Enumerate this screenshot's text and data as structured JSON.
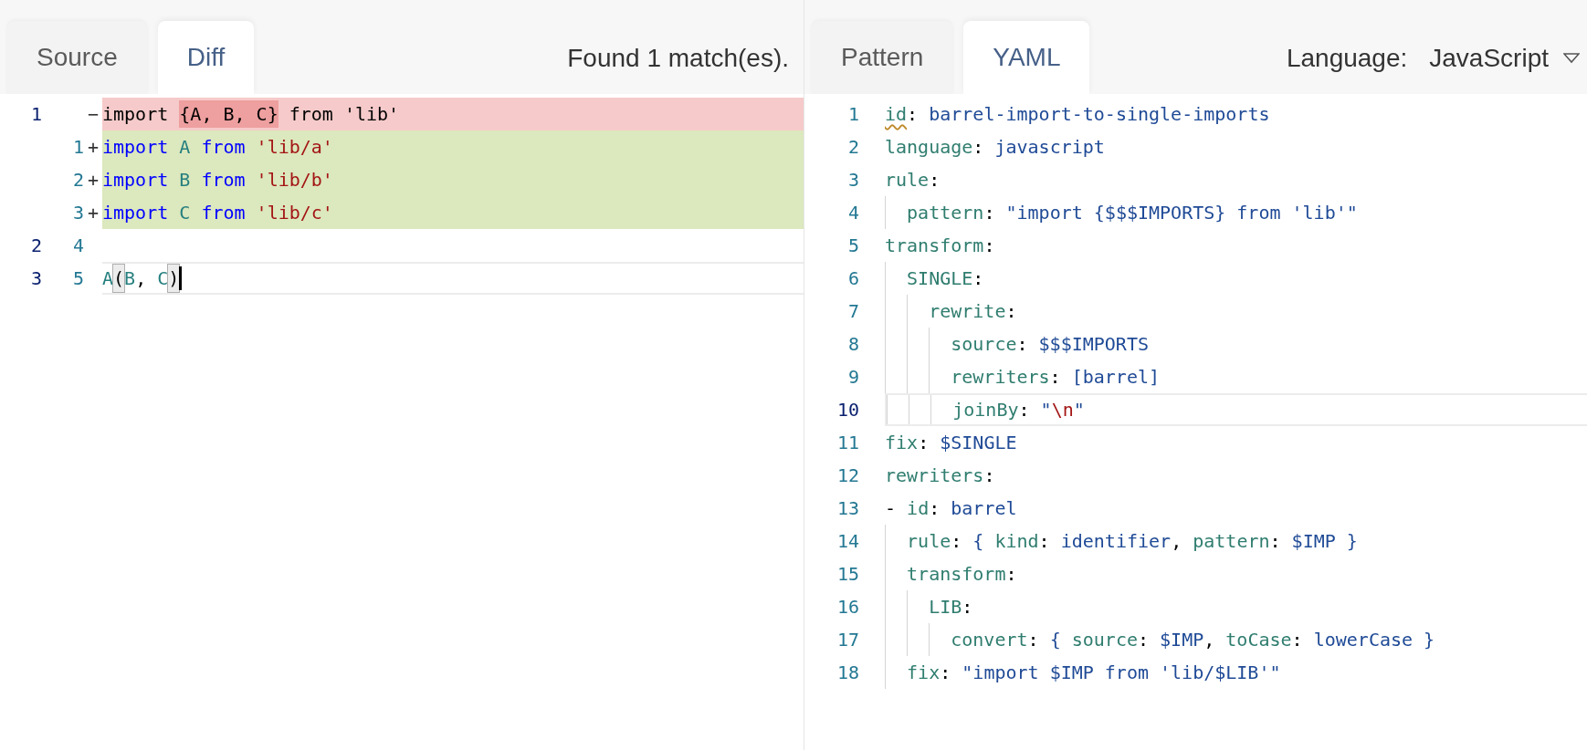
{
  "left_panel": {
    "tabs": [
      {
        "label": "Source",
        "selected": false
      },
      {
        "label": "Diff",
        "selected": true
      }
    ],
    "status": "Found 1 match(es).",
    "diff_lines": [
      {
        "old": "1",
        "marker": "−",
        "kind": "removed",
        "current": false,
        "cursor": false,
        "tokens": [
          {
            "text": "import ",
            "kind": "plain"
          },
          {
            "text": "{A, B, C}",
            "kind": "plain",
            "changed": true
          },
          {
            "text": " from 'lib'",
            "kind": "plain"
          }
        ]
      },
      {
        "new": "1",
        "marker": "+",
        "kind": "added",
        "current": false,
        "cursor": false,
        "tokens": [
          {
            "text": "import ",
            "kind": "kw"
          },
          {
            "text": "A ",
            "kind": "ident"
          },
          {
            "text": "from ",
            "kind": "kw"
          },
          {
            "text": "'lib/a'",
            "kind": "str"
          }
        ]
      },
      {
        "new": "2",
        "marker": "+",
        "kind": "added",
        "current": false,
        "cursor": false,
        "tokens": [
          {
            "text": "import ",
            "kind": "kw"
          },
          {
            "text": "B ",
            "kind": "ident"
          },
          {
            "text": "from ",
            "kind": "kw"
          },
          {
            "text": "'lib/b'",
            "kind": "str"
          }
        ]
      },
      {
        "new": "3",
        "marker": "+",
        "kind": "added",
        "current": false,
        "cursor": false,
        "tokens": [
          {
            "text": "import ",
            "kind": "kw"
          },
          {
            "text": "C ",
            "kind": "ident"
          },
          {
            "text": "from ",
            "kind": "kw"
          },
          {
            "text": "'lib/c'",
            "kind": "str"
          }
        ]
      },
      {
        "old": "2",
        "new": "4",
        "kind": "context",
        "current": false,
        "cursor": false
      },
      {
        "old": "3",
        "new": "5",
        "kind": "context",
        "current": true,
        "cursor": true,
        "tokens": [
          {
            "text": "A",
            "kind": "ident"
          },
          {
            "text": "(",
            "kind": "plain",
            "match": true
          },
          {
            "text": "B",
            "kind": "ident"
          },
          {
            "text": ", ",
            "kind": "plain"
          },
          {
            "text": "C",
            "kind": "ident"
          },
          {
            "text": ")",
            "kind": "plain",
            "match": true
          }
        ]
      }
    ]
  },
  "right_panel": {
    "tabs": [
      {
        "label": "Pattern",
        "selected": false
      },
      {
        "label": "YAML",
        "selected": true
      }
    ],
    "language_label": "Language:",
    "language": "JavaScript",
    "yaml_lines": [
      {
        "number": "1",
        "current": false,
        "tokens": [
          {
            "text": "id",
            "kind": "key",
            "warning": true
          },
          {
            "text": ": "
          },
          {
            "text": "barrel-import-to-single-imports",
            "kind": "val"
          }
        ]
      },
      {
        "number": "2",
        "current": false,
        "tokens": [
          {
            "text": "language",
            "kind": "key"
          },
          {
            "text": ": "
          },
          {
            "text": "javascript",
            "kind": "val"
          }
        ]
      },
      {
        "number": "3",
        "current": false,
        "tokens": [
          {
            "text": "rule",
            "kind": "key"
          },
          {
            "text": ":"
          }
        ],
        "children": [
          {
            "number": "4",
            "current": false,
            "tokens": [
              {
                "text": "pattern",
                "kind": "key"
              },
              {
                "text": ": "
              },
              {
                "text": "\"import {$$$IMPORTS} from 'lib'\"",
                "kind": "val"
              }
            ]
          }
        ]
      },
      {
        "number": "5",
        "current": false,
        "tokens": [
          {
            "text": "transform",
            "kind": "key"
          },
          {
            "text": ":"
          }
        ],
        "children": [
          {
            "number": "6",
            "current": false,
            "tokens": [
              {
                "text": "SINGLE",
                "kind": "key"
              },
              {
                "text": ":"
              }
            ],
            "children": [
              {
                "number": "7",
                "current": false,
                "tokens": [
                  {
                    "text": "rewrite",
                    "kind": "key"
                  },
                  {
                    "text": ":"
                  }
                ],
                "children": [
                  {
                    "number": "8",
                    "current": false,
                    "tokens": [
                      {
                        "text": "source",
                        "kind": "key"
                      },
                      {
                        "text": ": "
                      },
                      {
                        "text": "$$$IMPORTS",
                        "kind": "val"
                      }
                    ]
                  },
                  {
                    "number": "9",
                    "current": false,
                    "tokens": [
                      {
                        "text": "rewriters",
                        "kind": "key"
                      },
                      {
                        "text": ": "
                      },
                      {
                        "text": "[barrel]",
                        "kind": "val"
                      }
                    ]
                  },
                  {
                    "number": "10",
                    "current": true,
                    "tokens": [
                      {
                        "text": "joinBy",
                        "kind": "key"
                      },
                      {
                        "text": ": "
                      },
                      {
                        "text": "\"",
                        "kind": "val"
                      },
                      {
                        "text": "\\n",
                        "kind": "str"
                      },
                      {
                        "text": "\"",
                        "kind": "val"
                      }
                    ]
                  }
                ]
              }
            ]
          }
        ]
      },
      {
        "number": "11",
        "current": false,
        "tokens": [
          {
            "text": "fix",
            "kind": "key"
          },
          {
            "text": ": "
          },
          {
            "text": "$SINGLE",
            "kind": "val"
          }
        ]
      },
      {
        "number": "12",
        "current": false,
        "tokens": [
          {
            "text": "rewriters",
            "kind": "key"
          },
          {
            "text": ":"
          }
        ]
      },
      {
        "number": "13",
        "current": false,
        "tokens": [
          {
            "text": "- "
          },
          {
            "text": "id",
            "kind": "key"
          },
          {
            "text": ": "
          },
          {
            "text": "barrel",
            "kind": "val"
          }
        ],
        "children": [
          {
            "number": "14",
            "current": false,
            "tokens": [
              {
                "text": "rule",
                "kind": "key"
              },
              {
                "text": ": "
              },
              {
                "text": "{ ",
                "kind": "val"
              },
              {
                "text": "kind",
                "kind": "key"
              },
              {
                "text": ": "
              },
              {
                "text": "identifier",
                "kind": "val"
              },
              {
                "text": ", "
              },
              {
                "text": "pattern",
                "kind": "key"
              },
              {
                "text": ": "
              },
              {
                "text": "$IMP }",
                "kind": "val"
              }
            ]
          },
          {
            "number": "15",
            "current": false,
            "tokens": [
              {
                "text": "transform",
                "kind": "key"
              },
              {
                "text": ":"
              }
            ],
            "children": [
              {
                "number": "16",
                "current": false,
                "tokens": [
                  {
                    "text": "LIB",
                    "kind": "key"
                  },
                  {
                    "text": ":"
                  }
                ],
                "children": [
                  {
                    "number": "17",
                    "current": false,
                    "tokens": [
                      {
                        "text": "convert",
                        "kind": "key"
                      },
                      {
                        "text": ": "
                      },
                      {
                        "text": "{ ",
                        "kind": "val"
                      },
                      {
                        "text": "source",
                        "kind": "key"
                      },
                      {
                        "text": ": "
                      },
                      {
                        "text": "$IMP",
                        "kind": "val"
                      },
                      {
                        "text": ", "
                      },
                      {
                        "text": "toCase",
                        "kind": "key"
                      },
                      {
                        "text": ": "
                      },
                      {
                        "text": "lowerCase }",
                        "kind": "val"
                      }
                    ]
                  }
                ]
              }
            ]
          },
          {
            "number": "18",
            "current": false,
            "tokens": [
              {
                "text": "fix",
                "kind": "key"
              },
              {
                "text": ": "
              },
              {
                "text": "\"import $IMP from 'lib/$LIB'\"",
                "kind": "val"
              }
            ]
          }
        ]
      }
    ]
  }
}
